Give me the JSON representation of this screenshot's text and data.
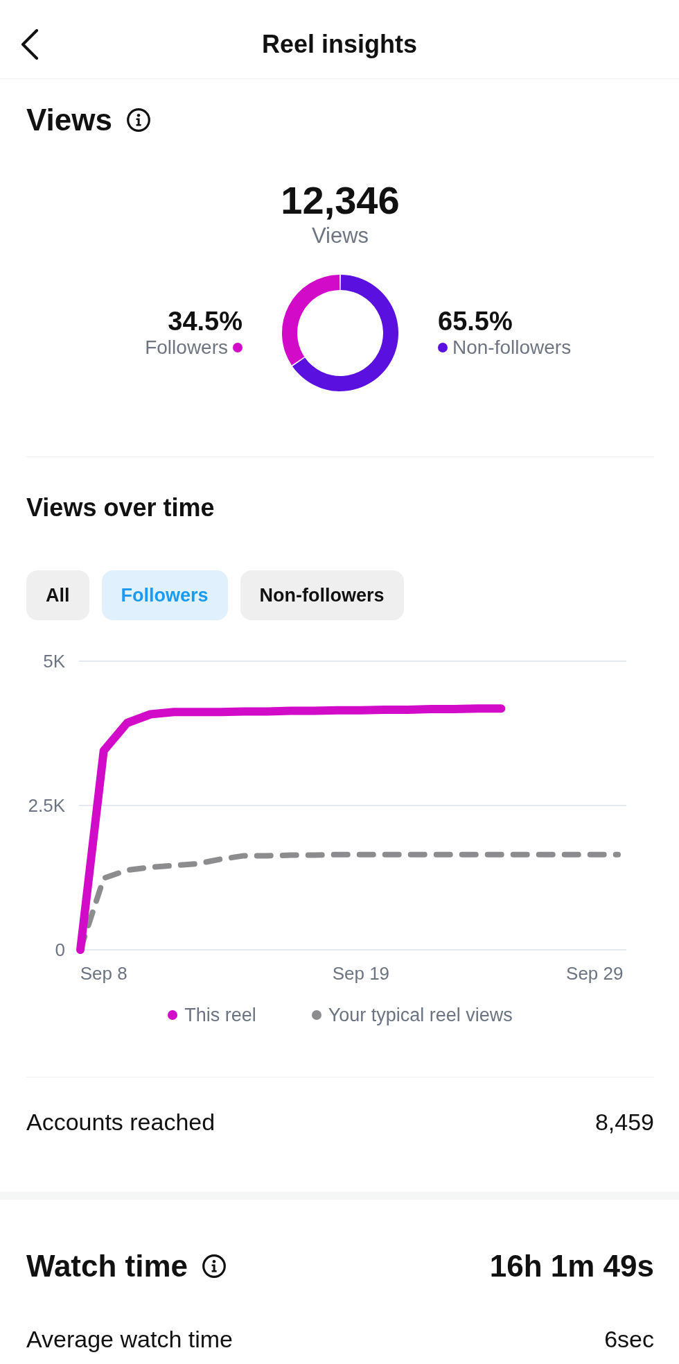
{
  "header": {
    "title": "Reel insights"
  },
  "views": {
    "title": "Views",
    "total": "12,346",
    "total_label": "Views",
    "chart_data": {
      "type": "donut",
      "categories": [
        "Followers",
        "Non-followers"
      ],
      "values": [
        34.5,
        65.5
      ],
      "colors": [
        "#d10bc8",
        "#5a10df"
      ],
      "value_labels": [
        "34.5%",
        "65.5%"
      ]
    }
  },
  "views_over_time": {
    "title": "Views over time",
    "filters": [
      {
        "label": "All",
        "selected": false
      },
      {
        "label": "Followers",
        "selected": true
      },
      {
        "label": "Non-followers",
        "selected": false
      }
    ],
    "chart_data": {
      "type": "line",
      "categories": [
        null,
        "Sep 8",
        null,
        null,
        null,
        null,
        null,
        null,
        null,
        null,
        null,
        null,
        "Sep 19",
        null,
        null,
        null,
        null,
        null,
        null,
        null,
        null,
        null,
        "Sep 29",
        null
      ],
      "ylim": [
        0,
        5000
      ],
      "yticks": [
        {
          "value": 0,
          "label": "0"
        },
        {
          "value": 2500,
          "label": "2.5K"
        },
        {
          "value": 5000,
          "label": "5K"
        }
      ],
      "series": [
        {
          "name": "This reel",
          "color": "#d10bc8",
          "line_style": "solid",
          "values": [
            0,
            3450,
            3930,
            4080,
            4120,
            4120,
            4120,
            4130,
            4130,
            4140,
            4140,
            4150,
            4150,
            4160,
            4160,
            4170,
            4170,
            4180,
            4180,
            null,
            null,
            null,
            null,
            null
          ]
        },
        {
          "name": "Your typical reel views",
          "color": "#8c8c8e",
          "line_style": "dashed",
          "values": [
            0,
            1240,
            1380,
            1430,
            1460,
            1490,
            1570,
            1630,
            1630,
            1640,
            1640,
            1650,
            1650,
            1650,
            1650,
            1650,
            1650,
            1650,
            1650,
            1650,
            1650,
            1650,
            1650,
            1650
          ]
        }
      ]
    }
  },
  "reach_rows": [
    {
      "label": "Accounts reached",
      "value": "8,459"
    }
  ],
  "watch_time": {
    "title": "Watch time",
    "total": "16h 1m 49s",
    "rows": [
      {
        "label": "Average watch time",
        "value": "6sec"
      }
    ]
  }
}
